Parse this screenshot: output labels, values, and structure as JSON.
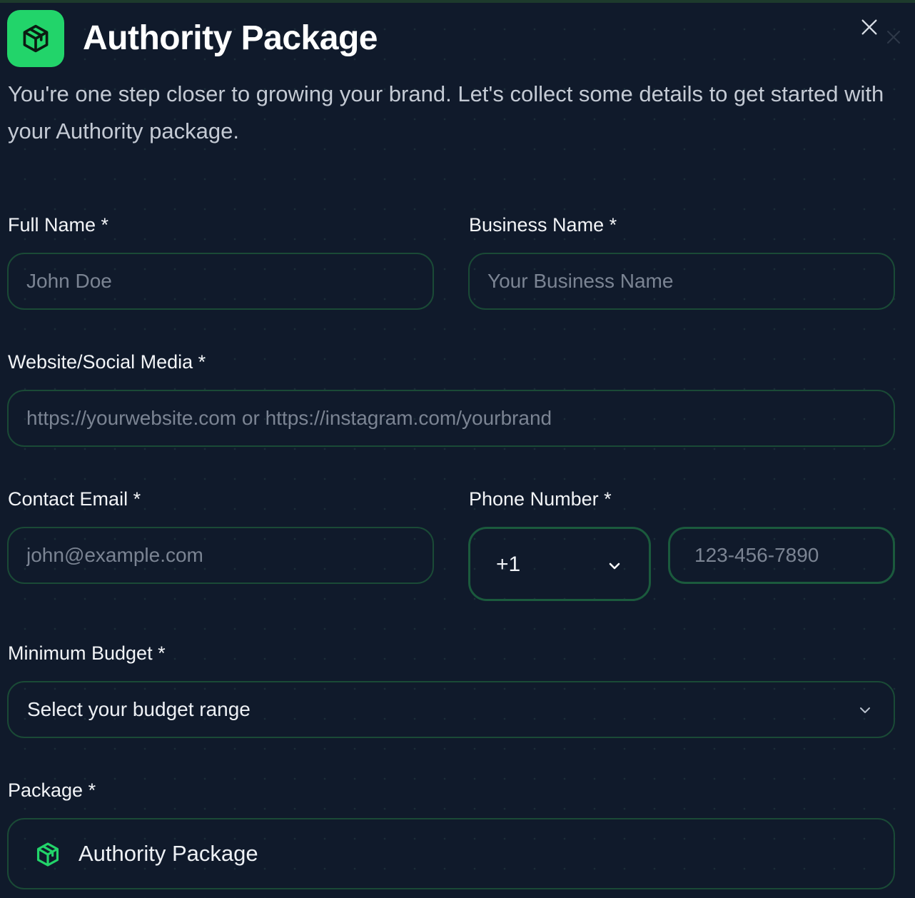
{
  "dialog": {
    "title": "Authority Package",
    "subtitle": "You're one step closer to growing your brand. Let's collect some details to get started with your Authority package.",
    "accent_color": "#22d46a",
    "icon": "package-icon",
    "close_icon": "close-icon"
  },
  "form": {
    "full_name": {
      "label": "Full Name *",
      "placeholder": "John Doe",
      "value": ""
    },
    "business_name": {
      "label": "Business Name *",
      "placeholder": "Your Business Name",
      "value": ""
    },
    "website": {
      "label": "Website/Social Media *",
      "placeholder": "https://yourwebsite.com or https://instagram.com/yourbrand",
      "value": ""
    },
    "contact_email": {
      "label": "Contact Email *",
      "placeholder": "john@example.com",
      "value": ""
    },
    "phone": {
      "label": "Phone Number *",
      "country_code": "+1",
      "placeholder": "123-456-7890",
      "value": ""
    },
    "budget": {
      "label": "Minimum Budget *",
      "selected": "Select your budget range"
    },
    "package": {
      "label": "Package *",
      "selected": "Authority Package",
      "icon": "package-icon"
    }
  },
  "colors": {
    "background": "#101a2b",
    "field_border": "#1a4a36",
    "text": "#f2f4f7",
    "placeholder": "#7b8493"
  }
}
